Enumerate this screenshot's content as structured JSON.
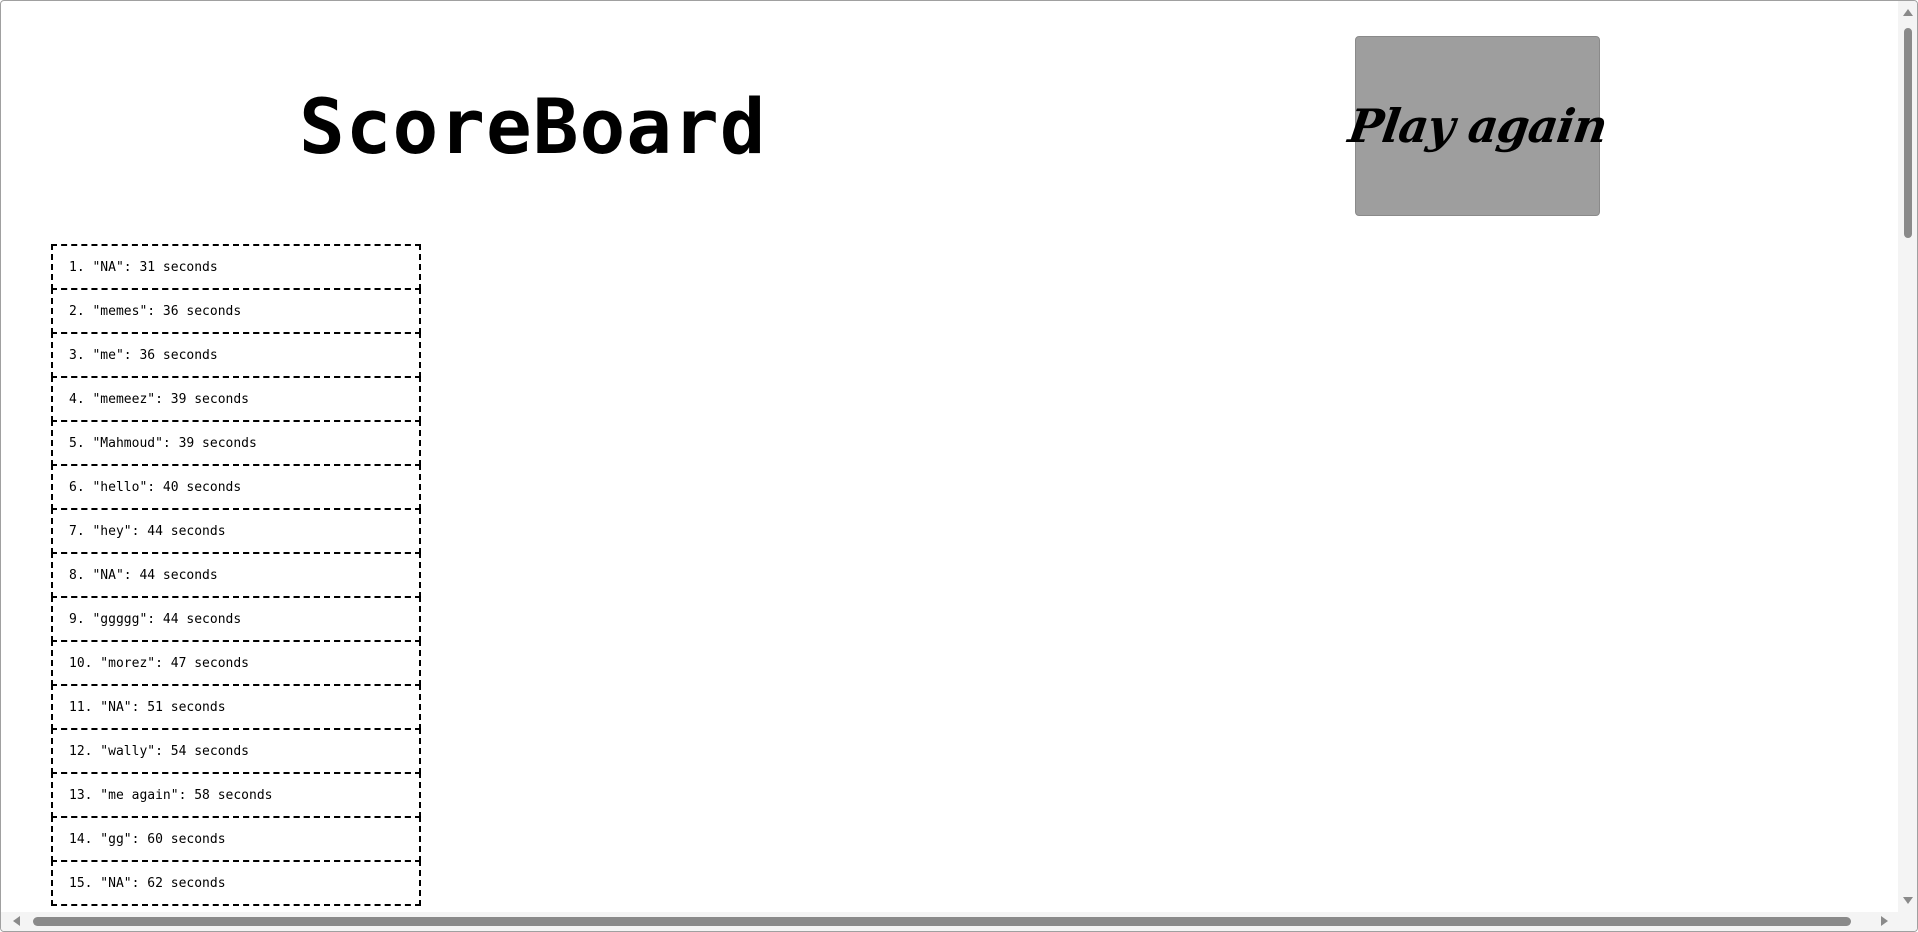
{
  "page": {
    "title": "ScoreBoard",
    "play_again_label": "Play again"
  },
  "scores": [
    {
      "rank": 1,
      "name": "NA",
      "time": 31,
      "text": "1. \"NA\": 31 seconds"
    },
    {
      "rank": 2,
      "name": "memes",
      "time": 36,
      "text": "2. \"memes\": 36 seconds"
    },
    {
      "rank": 3,
      "name": "me",
      "time": 36,
      "text": "3. \"me\": 36 seconds"
    },
    {
      "rank": 4,
      "name": "memeez",
      "time": 39,
      "text": "4. \"memeez\": 39 seconds"
    },
    {
      "rank": 5,
      "name": "Mahmoud",
      "time": 39,
      "text": "5. \"Mahmoud\": 39 seconds"
    },
    {
      "rank": 6,
      "name": "hello",
      "time": 40,
      "text": "6. \"hello\": 40 seconds"
    },
    {
      "rank": 7,
      "name": "hey",
      "time": 44,
      "text": "7. \"hey\": 44 seconds"
    },
    {
      "rank": 8,
      "name": "NA",
      "time": 44,
      "text": "8. \"NA\": 44 seconds"
    },
    {
      "rank": 9,
      "name": "ggggg",
      "time": 44,
      "text": "9. \"ggggg\": 44 seconds"
    },
    {
      "rank": 10,
      "name": "morez",
      "time": 47,
      "text": "10. \"morez\": 47 seconds"
    },
    {
      "rank": 11,
      "name": "NA",
      "time": 51,
      "text": "11. \"NA\": 51 seconds"
    },
    {
      "rank": 12,
      "name": "wally",
      "time": 54,
      "text": "12. \"wally\": 54 seconds"
    },
    {
      "rank": 13,
      "name": "me again",
      "time": 58,
      "text": "13. \"me again\": 58 seconds"
    },
    {
      "rank": 14,
      "name": "gg",
      "time": 60,
      "text": "14. \"gg\": 60 seconds"
    },
    {
      "rank": 15,
      "name": "NA",
      "time": 62,
      "text": "15. \"NA\": 62 seconds"
    }
  ],
  "colors": {
    "button_bg": "#9e9e9e",
    "border": "#000000",
    "background": "#ffffff"
  }
}
